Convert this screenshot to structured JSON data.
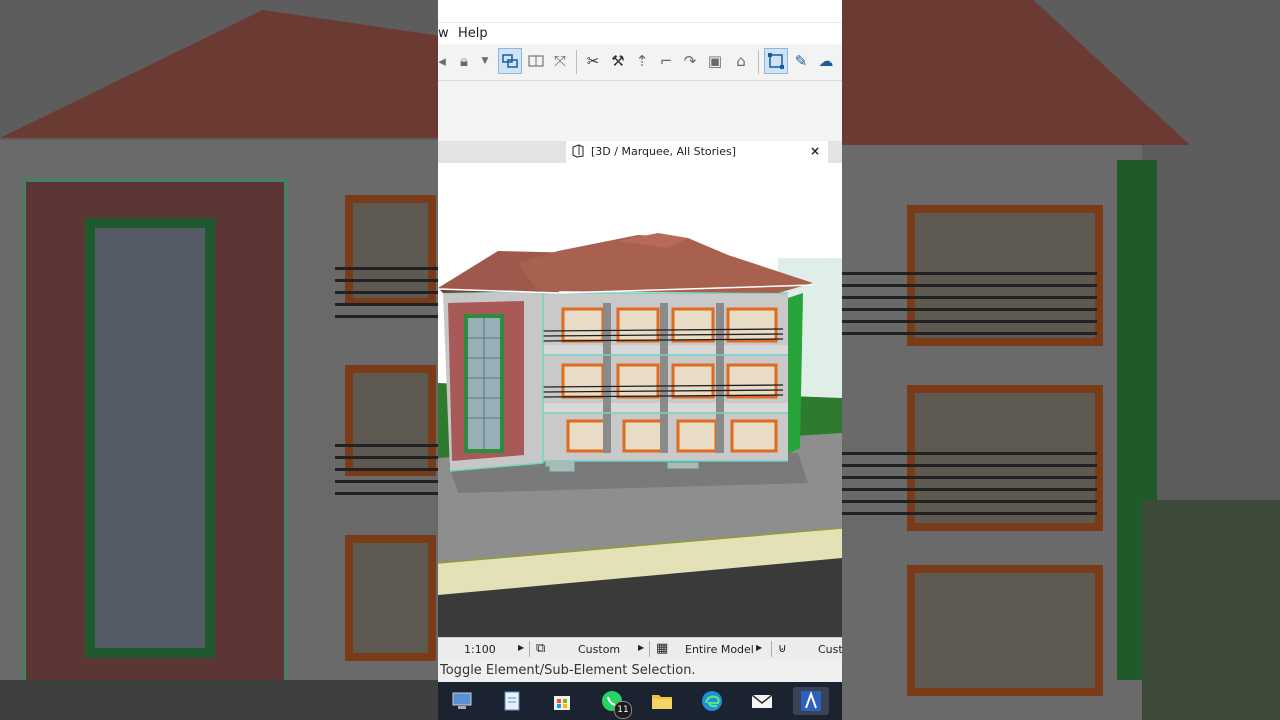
{
  "menu": {
    "partial_item": "w",
    "help": "Help"
  },
  "tab": {
    "title": "[3D / Marquee, All Stories]",
    "close": "×"
  },
  "status": {
    "scale": "1:100",
    "layer_combo": "Custom",
    "model_view": "Entire Model",
    "partial": "Cust"
  },
  "hint": "Toggle Element/Sub-Element Selection.",
  "taskbar": {
    "whatsapp_badge": "11"
  },
  "colors": {
    "roof": "#a0584c",
    "wall": "#c9c9c9",
    "brick": "#a85a58",
    "accent_orange": "#e06a1e",
    "green_trim": "#2e8c3e",
    "ground": "#8e8e8e",
    "grass": "#2e7a2e",
    "sand": "#e4e1b6"
  }
}
